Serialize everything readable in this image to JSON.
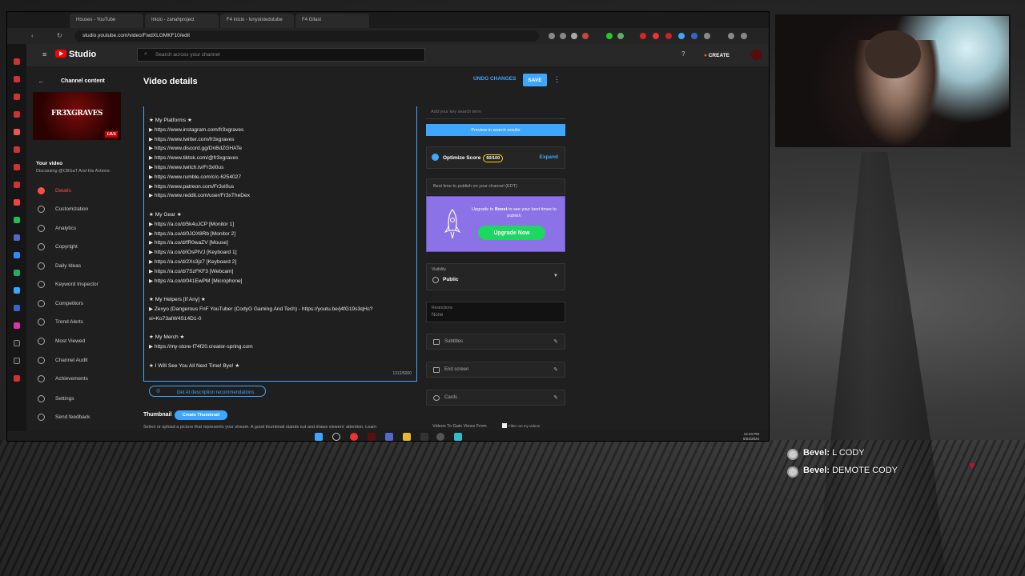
{
  "browser": {
    "tabs": [
      "Houses - YouTube",
      "Inicio - zanahproject",
      "F4 inicio - lunyoistedutube",
      "F4 Gilast"
    ],
    "url": "studio.youtube.com/video/FwdXLGMKF10/edit"
  },
  "header": {
    "logo": "Studio",
    "search_placeholder": "Search across your channel",
    "create_label": "CREATE"
  },
  "sidebar": {
    "channel_content": "Channel content",
    "thumb_text": "FR3XGRAVES",
    "live_badge": "LIVE",
    "your_video": "Your video",
    "your_video_sub": "Discussing @CBGaT And His Actions.",
    "items": [
      {
        "label": "Details",
        "active": true
      },
      {
        "label": "Customization"
      },
      {
        "label": "Analytics"
      },
      {
        "label": "Copyright"
      },
      {
        "label": "Daily Ideas"
      },
      {
        "label": "Keyword Inspector"
      },
      {
        "label": "Competitors"
      },
      {
        "label": "Trend Alerts"
      },
      {
        "label": "Most Viewed"
      },
      {
        "label": "Channel Audit"
      },
      {
        "label": "Achievements"
      },
      {
        "label": "Settings"
      },
      {
        "label": "Send feedback"
      }
    ]
  },
  "main": {
    "title": "Video details",
    "undo_label": "UNDO CHANGES",
    "save_label": "SAVE",
    "description_lines": [
      "★ My Platforms ★",
      "▶ https://www.instagram.com/fr3xgraves",
      "▶ https://www.twitter.com/fr3xgraves",
      "▶ https://www.discord.gg/DnBdZGHATe",
      "▶ https://www.tiktok.com/@fr3xgraves",
      "▶ https://www.twitch.tv/Fr3xl0us",
      "▶ https://www.rumble.com/c/c-6254027",
      "▶ https://www.patreon.com/Fr3xl0us",
      "▶ https://www.reddit.com/user/Fr3xTheDex",
      "",
      "★ My Gear ★",
      "▶ https://a.co/d/5k4uJCP [Monitor 1]",
      "▶ https://a.co/d/0JOX8Rb [Monitor 2]",
      "▶ https://a.co/d/fR0waZV [Mouse]",
      "▶ https://a.co/d/iOsPIVJ [Keyboard 1]",
      "▶ https://a.co/d/2Xs3jz7 [Keyboard 2]",
      "▶ https://a.co/d/7SzFKF3 [Webcam]",
      "▶ https://a.co/d/041EwPM [Microphone]",
      "",
      "★ My Helpers [If Any] ★",
      "▶ Zexyo (Dangerous FnF YouTuber (CodyG Gaming And Tech) - https://youtu.be/j4fG19s3qHc?",
      "si=Ko73aIW4S14D1-0",
      "",
      "★ My Merch ★",
      "▶ https://my-store-f74f20.creator-spring.com",
      "",
      "★ I Will See You All Next Time! Bye! ★"
    ],
    "char_count": "1312/5000",
    "ai_button": "Get AI description recommendations",
    "thumbnail_label": "Thumbnail",
    "create_thumbnail": "Create Thumbnail",
    "thumbnail_sub": "Select or upload a picture that represents your stream. A good thumbnail stands out and draws viewers' attention. Learn"
  },
  "right": {
    "key_search_placeholder": "Add your key search term",
    "preview_label": "Preview in search results",
    "optimize_label": "Optimize Score",
    "optimize_score": "60/100",
    "expand_label": "Expand",
    "best_time": "Best time to publish on your channel (EDT)",
    "boost_text_1": "Upgrade to",
    "boost_text_bold": "Boost",
    "boost_text_2": "to see your best times to publish",
    "upgrade_label": "Upgrade Now",
    "visibility_label": "Visibility",
    "visibility_value": "Public",
    "restrictions_label": "Restrictions",
    "restrictions_value": "None",
    "subtitles": "Subtitles",
    "end_screen": "End screen",
    "cards": "Cards",
    "videos_to_gain": "Videos To Gain Views From",
    "filter_label": "Filter out my videos"
  },
  "taskbar": {
    "time": "12:43 PM",
    "date": "6/24/2024"
  },
  "chat": [
    {
      "user": "Bevel:",
      "message": "L CODY"
    },
    {
      "user": "Bevel:",
      "message": "DEMOTE CODY"
    }
  ]
}
